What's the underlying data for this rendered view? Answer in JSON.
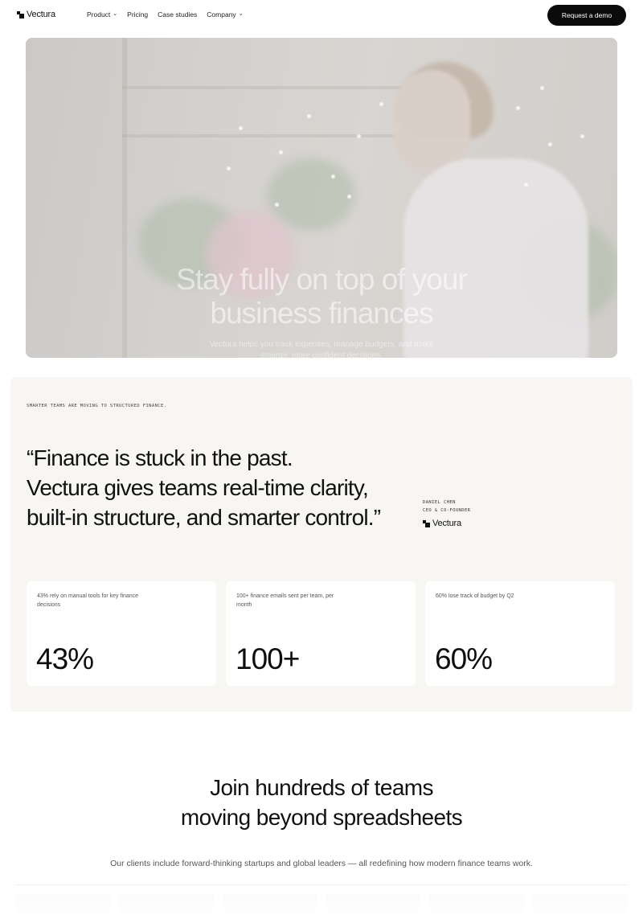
{
  "nav": {
    "brand": "Vectura",
    "links": [
      {
        "label": "Product",
        "dropdown": true
      },
      {
        "label": "Pricing",
        "dropdown": false
      },
      {
        "label": "Case studies",
        "dropdown": false
      },
      {
        "label": "Company",
        "dropdown": true
      }
    ],
    "cta": "Request a demo"
  },
  "hero": {
    "title_line1": "Stay fully on top of your",
    "title_line2": "business finances",
    "subtitle_line1": "Vectura helps you track expenses, manage budgets, and make",
    "subtitle_line2": "smarter, more confident decisions."
  },
  "quote_section": {
    "eyebrow": "SMARTER TEAMS ARE MOVING TO STRUCTURED FINANCE.",
    "quote_line1": "“Finance is stuck in the past.",
    "quote_line2": "Vectura gives teams real-time clarity,",
    "quote_line3": "built-in structure, and smarter control.”",
    "author_name": "DANIEL CHEN",
    "author_role": "CEO & CO-FOUNDER",
    "author_company": "Vectura",
    "stats": [
      {
        "label": "43% rely on manual tools for key finance decisions",
        "value": "43%"
      },
      {
        "label": "100+ finance emails sent per team, per month",
        "value": "100+"
      },
      {
        "label": "60% lose track of budget by Q2",
        "value": "60%"
      }
    ]
  },
  "join": {
    "title_line1": "Join hundreds of teams",
    "title_line2": "moving beyond spreadsheets",
    "subtitle": "Our clients include forward-thinking startups and global leaders — all redefining how modern finance teams work."
  },
  "colors": {
    "cta_bg": "#0b0b0b",
    "section_bg": "#f8f6f3",
    "text": "#111111"
  }
}
